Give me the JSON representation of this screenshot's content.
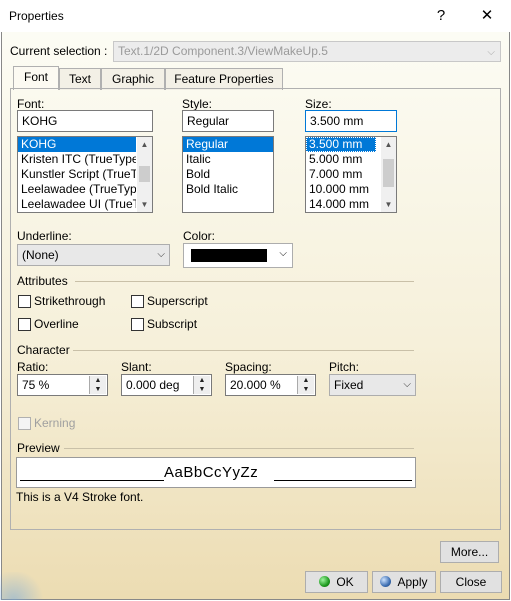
{
  "window": {
    "title": "Properties",
    "help_glyph": "?",
    "close_glyph": "✕"
  },
  "selection": {
    "label": "Current selection :",
    "value": "Text.1/2D Component.3/ViewMakeUp.5"
  },
  "tabs": [
    {
      "label": "Font",
      "active": true
    },
    {
      "label": "Text",
      "active": false
    },
    {
      "label": "Graphic",
      "active": false
    },
    {
      "label": "Feature Properties",
      "active": false
    }
  ],
  "font": {
    "label": "Font:",
    "value": "KOHG",
    "items": [
      "KOHG",
      "Kristen ITC (TrueType",
      "Kunstler Script (TrueT",
      "Leelawadee (TrueType",
      "Leelawadee UI (TrueT"
    ]
  },
  "style": {
    "label": "Style:",
    "value": "Regular",
    "items": [
      "Regular",
      "Italic",
      "Bold",
      "Bold Italic"
    ]
  },
  "size": {
    "label": "Size:",
    "value": "3.500 mm",
    "items": [
      "3.500 mm",
      "5.000 mm",
      "7.000 mm",
      "10.000 mm",
      "14.000 mm"
    ]
  },
  "underline": {
    "label": "Underline:",
    "value": "(None)"
  },
  "color": {
    "label": "Color:",
    "value_color": "#000000"
  },
  "attributes": {
    "label": "Attributes",
    "strikethrough": "Strikethrough",
    "superscript": "Superscript",
    "overline": "Overline",
    "subscript": "Subscript"
  },
  "character": {
    "label": "Character",
    "ratio_label": "Ratio:",
    "ratio_value": "75 %",
    "slant_label": "Slant:",
    "slant_value": "0.000 deg",
    "spacing_label": "Spacing:",
    "spacing_value": "20.000 %",
    "pitch_label": "Pitch:",
    "pitch_value": "Fixed"
  },
  "kerning": {
    "label": "Kerning"
  },
  "preview": {
    "label": "Preview",
    "sample": "AaBbCcYyZz",
    "note": "This is a V4 Stroke font."
  },
  "buttons": {
    "more": "More...",
    "ok": "OK",
    "apply": "Apply",
    "close": "Close"
  },
  "colors": {
    "selection_blue": "#0078d7",
    "background_light": "#fcfcf4",
    "background_warm": "#ecdcb2"
  }
}
